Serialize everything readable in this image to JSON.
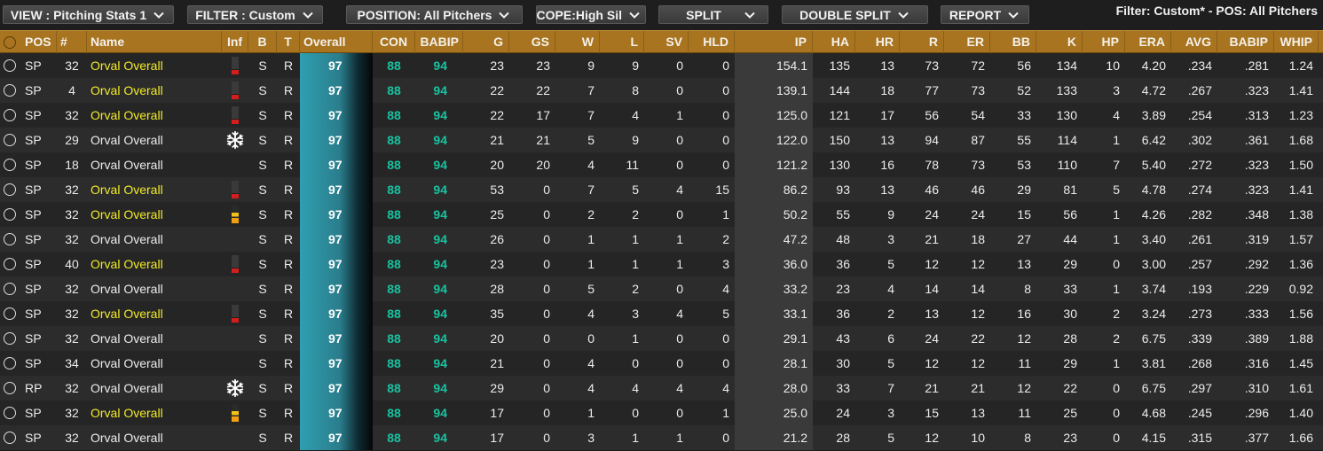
{
  "toolbar": {
    "view": "VIEW : Pitching Stats 1",
    "filter": "FILTER : Custom",
    "position": "POSITION: All Pitchers",
    "scope": "SCOPE:High Sil",
    "split": "SPLIT",
    "double_split": "DOUBLE SPLIT",
    "report": "REPORT",
    "filter_summary": "Filter: Custom* - POS: All Pitchers"
  },
  "columns": [
    "POS",
    "#",
    "Name",
    "Inf",
    "B",
    "T",
    "Overall",
    "CON",
    "BABIP",
    "G",
    "GS",
    "W",
    "L",
    "SV",
    "HLD",
    "IP",
    "HA",
    "HR",
    "R",
    "ER",
    "BB",
    "K",
    "HP",
    "ERA",
    "AVG",
    "BABIP",
    "WHIP"
  ],
  "rows": [
    {
      "pos": "SP",
      "num": "32",
      "name": "Orval Overall",
      "highlight": true,
      "inf": "red",
      "b": "S",
      "t": "R",
      "overall": "97",
      "con": "88",
      "babip_r": "94",
      "g": "23",
      "gs": "23",
      "w": "9",
      "l": "9",
      "sv": "0",
      "hld": "0",
      "ip": "154.1",
      "ha": "135",
      "hr": "13",
      "r": "73",
      "er": "72",
      "bb": "56",
      "k": "134",
      "hp": "10",
      "era": "4.20",
      "avg": ".234",
      "babip": ".281",
      "whip": "1.24"
    },
    {
      "pos": "SP",
      "num": "4",
      "name": "Orval Overall",
      "highlight": true,
      "inf": "red",
      "b": "S",
      "t": "R",
      "overall": "97",
      "con": "88",
      "babip_r": "94",
      "g": "22",
      "gs": "22",
      "w": "7",
      "l": "8",
      "sv": "0",
      "hld": "0",
      "ip": "139.1",
      "ha": "144",
      "hr": "18",
      "r": "77",
      "er": "73",
      "bb": "52",
      "k": "133",
      "hp": "3",
      "era": "4.72",
      "avg": ".267",
      "babip": ".323",
      "whip": "1.41"
    },
    {
      "pos": "SP",
      "num": "32",
      "name": "Orval Overall",
      "highlight": true,
      "inf": "red",
      "b": "S",
      "t": "R",
      "overall": "97",
      "con": "88",
      "babip_r": "94",
      "g": "22",
      "gs": "17",
      "w": "7",
      "l": "4",
      "sv": "1",
      "hld": "0",
      "ip": "125.0",
      "ha": "121",
      "hr": "17",
      "r": "56",
      "er": "54",
      "bb": "33",
      "k": "130",
      "hp": "4",
      "era": "3.89",
      "avg": ".254",
      "babip": ".313",
      "whip": "1.23"
    },
    {
      "pos": "SP",
      "num": "29",
      "name": "Orval Overall",
      "highlight": false,
      "inf": "snow",
      "b": "S",
      "t": "R",
      "overall": "97",
      "con": "88",
      "babip_r": "94",
      "g": "21",
      "gs": "21",
      "w": "5",
      "l": "9",
      "sv": "0",
      "hld": "0",
      "ip": "122.0",
      "ha": "150",
      "hr": "13",
      "r": "94",
      "er": "87",
      "bb": "55",
      "k": "114",
      "hp": "1",
      "era": "6.42",
      "avg": ".302",
      "babip": ".361",
      "whip": "1.68"
    },
    {
      "pos": "SP",
      "num": "18",
      "name": "Orval Overall",
      "highlight": false,
      "inf": "",
      "b": "S",
      "t": "R",
      "overall": "97",
      "con": "88",
      "babip_r": "94",
      "g": "20",
      "gs": "20",
      "w": "4",
      "l": "11",
      "sv": "0",
      "hld": "0",
      "ip": "121.2",
      "ha": "130",
      "hr": "16",
      "r": "78",
      "er": "73",
      "bb": "53",
      "k": "110",
      "hp": "7",
      "era": "5.40",
      "avg": ".272",
      "babip": ".323",
      "whip": "1.50"
    },
    {
      "pos": "SP",
      "num": "32",
      "name": "Orval Overall",
      "highlight": true,
      "inf": "red",
      "b": "S",
      "t": "R",
      "overall": "97",
      "con": "88",
      "babip_r": "94",
      "g": "53",
      "gs": "0",
      "w": "7",
      "l": "5",
      "sv": "4",
      "hld": "15",
      "ip": "86.2",
      "ha": "93",
      "hr": "13",
      "r": "46",
      "er": "46",
      "bb": "29",
      "k": "81",
      "hp": "5",
      "era": "4.78",
      "avg": ".274",
      "babip": ".323",
      "whip": "1.41"
    },
    {
      "pos": "SP",
      "num": "32",
      "name": "Orval Overall",
      "highlight": true,
      "inf": "yel",
      "b": "S",
      "t": "R",
      "overall": "97",
      "con": "88",
      "babip_r": "94",
      "g": "25",
      "gs": "0",
      "w": "2",
      "l": "2",
      "sv": "0",
      "hld": "1",
      "ip": "50.2",
      "ha": "55",
      "hr": "9",
      "r": "24",
      "er": "24",
      "bb": "15",
      "k": "56",
      "hp": "1",
      "era": "4.26",
      "avg": ".282",
      "babip": ".348",
      "whip": "1.38"
    },
    {
      "pos": "SP",
      "num": "32",
      "name": "Orval Overall",
      "highlight": false,
      "inf": "",
      "b": "S",
      "t": "R",
      "overall": "97",
      "con": "88",
      "babip_r": "94",
      "g": "26",
      "gs": "0",
      "w": "1",
      "l": "1",
      "sv": "1",
      "hld": "2",
      "ip": "47.2",
      "ha": "48",
      "hr": "3",
      "r": "21",
      "er": "18",
      "bb": "27",
      "k": "44",
      "hp": "1",
      "era": "3.40",
      "avg": ".261",
      "babip": ".319",
      "whip": "1.57"
    },
    {
      "pos": "SP",
      "num": "40",
      "name": "Orval Overall",
      "highlight": true,
      "inf": "red",
      "b": "S",
      "t": "R",
      "overall": "97",
      "con": "88",
      "babip_r": "94",
      "g": "23",
      "gs": "0",
      "w": "1",
      "l": "1",
      "sv": "1",
      "hld": "3",
      "ip": "36.0",
      "ha": "36",
      "hr": "5",
      "r": "12",
      "er": "12",
      "bb": "13",
      "k": "29",
      "hp": "0",
      "era": "3.00",
      "avg": ".257",
      "babip": ".292",
      "whip": "1.36"
    },
    {
      "pos": "SP",
      "num": "32",
      "name": "Orval Overall",
      "highlight": false,
      "inf": "",
      "b": "S",
      "t": "R",
      "overall": "97",
      "con": "88",
      "babip_r": "94",
      "g": "28",
      "gs": "0",
      "w": "5",
      "l": "2",
      "sv": "0",
      "hld": "4",
      "ip": "33.2",
      "ha": "23",
      "hr": "4",
      "r": "14",
      "er": "14",
      "bb": "8",
      "k": "33",
      "hp": "1",
      "era": "3.74",
      "avg": ".193",
      "babip": ".229",
      "whip": "0.92"
    },
    {
      "pos": "SP",
      "num": "32",
      "name": "Orval Overall",
      "highlight": true,
      "inf": "red",
      "b": "S",
      "t": "R",
      "overall": "97",
      "con": "88",
      "babip_r": "94",
      "g": "35",
      "gs": "0",
      "w": "4",
      "l": "3",
      "sv": "4",
      "hld": "5",
      "ip": "33.1",
      "ha": "36",
      "hr": "2",
      "r": "13",
      "er": "12",
      "bb": "16",
      "k": "30",
      "hp": "2",
      "era": "3.24",
      "avg": ".273",
      "babip": ".333",
      "whip": "1.56"
    },
    {
      "pos": "SP",
      "num": "32",
      "name": "Orval Overall",
      "highlight": false,
      "inf": "",
      "b": "S",
      "t": "R",
      "overall": "97",
      "con": "88",
      "babip_r": "94",
      "g": "20",
      "gs": "0",
      "w": "0",
      "l": "1",
      "sv": "0",
      "hld": "0",
      "ip": "29.1",
      "ha": "43",
      "hr": "6",
      "r": "24",
      "er": "22",
      "bb": "12",
      "k": "28",
      "hp": "2",
      "era": "6.75",
      "avg": ".339",
      "babip": ".389",
      "whip": "1.88"
    },
    {
      "pos": "SP",
      "num": "34",
      "name": "Orval Overall",
      "highlight": false,
      "inf": "",
      "b": "S",
      "t": "R",
      "overall": "97",
      "con": "88",
      "babip_r": "94",
      "g": "21",
      "gs": "0",
      "w": "4",
      "l": "0",
      "sv": "0",
      "hld": "0",
      "ip": "28.1",
      "ha": "30",
      "hr": "5",
      "r": "12",
      "er": "12",
      "bb": "11",
      "k": "29",
      "hp": "1",
      "era": "3.81",
      "avg": ".268",
      "babip": ".316",
      "whip": "1.45"
    },
    {
      "pos": "RP",
      "num": "32",
      "name": "Orval Overall",
      "highlight": false,
      "inf": "snow",
      "b": "S",
      "t": "R",
      "overall": "97",
      "con": "88",
      "babip_r": "94",
      "g": "29",
      "gs": "0",
      "w": "4",
      "l": "4",
      "sv": "4",
      "hld": "4",
      "ip": "28.0",
      "ha": "33",
      "hr": "7",
      "r": "21",
      "er": "21",
      "bb": "12",
      "k": "22",
      "hp": "0",
      "era": "6.75",
      "avg": ".297",
      "babip": ".310",
      "whip": "1.61"
    },
    {
      "pos": "SP",
      "num": "32",
      "name": "Orval Overall",
      "highlight": true,
      "inf": "yel",
      "b": "S",
      "t": "R",
      "overall": "97",
      "con": "88",
      "babip_r": "94",
      "g": "17",
      "gs": "0",
      "w": "1",
      "l": "0",
      "sv": "0",
      "hld": "1",
      "ip": "25.0",
      "ha": "24",
      "hr": "3",
      "r": "15",
      "er": "13",
      "bb": "11",
      "k": "25",
      "hp": "0",
      "era": "4.68",
      "avg": ".245",
      "babip": ".296",
      "whip": "1.40"
    },
    {
      "pos": "SP",
      "num": "32",
      "name": "Orval Overall",
      "highlight": false,
      "inf": "",
      "b": "S",
      "t": "R",
      "overall": "97",
      "con": "88",
      "babip_r": "94",
      "g": "17",
      "gs": "0",
      "w": "3",
      "l": "1",
      "sv": "1",
      "hld": "0",
      "ip": "21.2",
      "ha": "28",
      "hr": "5",
      "r": "12",
      "er": "10",
      "bb": "8",
      "k": "23",
      "hp": "0",
      "era": "4.15",
      "avg": ".315",
      "babip": ".377",
      "whip": "1.66"
    }
  ]
}
